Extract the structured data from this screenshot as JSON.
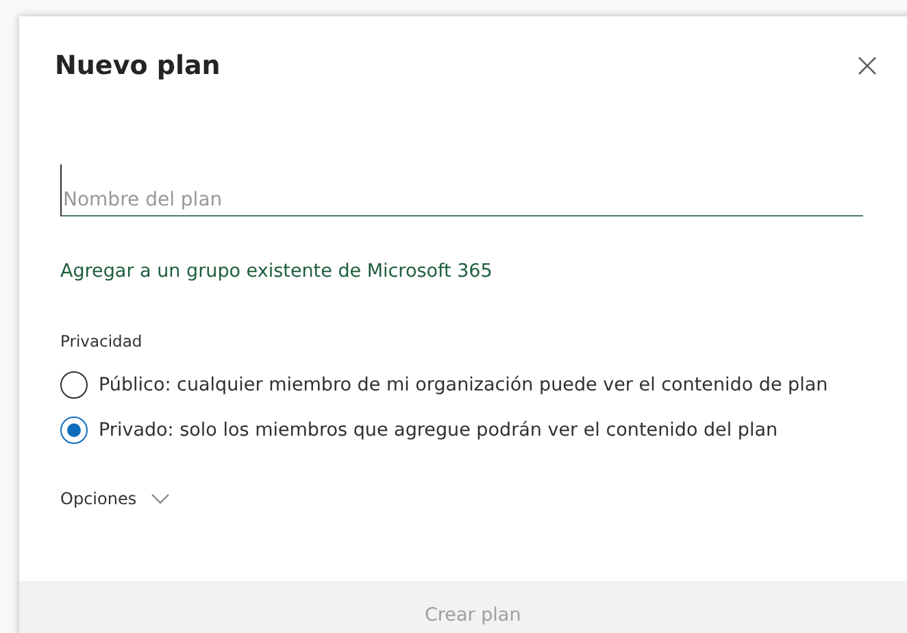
{
  "dialog": {
    "title": "Nuevo plan",
    "name_field": {
      "placeholder": "Nombre del plan"
    },
    "group_link": "Agregar a un grupo existente de Microsoft 365",
    "privacy": {
      "label": "Privacidad",
      "options": [
        {
          "label": "Público: cualquier miembro de mi organización puede ver el contenido de plan",
          "selected": false
        },
        {
          "label": "Privado: solo los miembros que agregue podrán ver el contenido del plan",
          "selected": true
        }
      ]
    },
    "options_toggle": {
      "label": "Opciones",
      "expanded": false
    },
    "create_button": {
      "label": "Crear plan",
      "disabled": true
    }
  }
}
